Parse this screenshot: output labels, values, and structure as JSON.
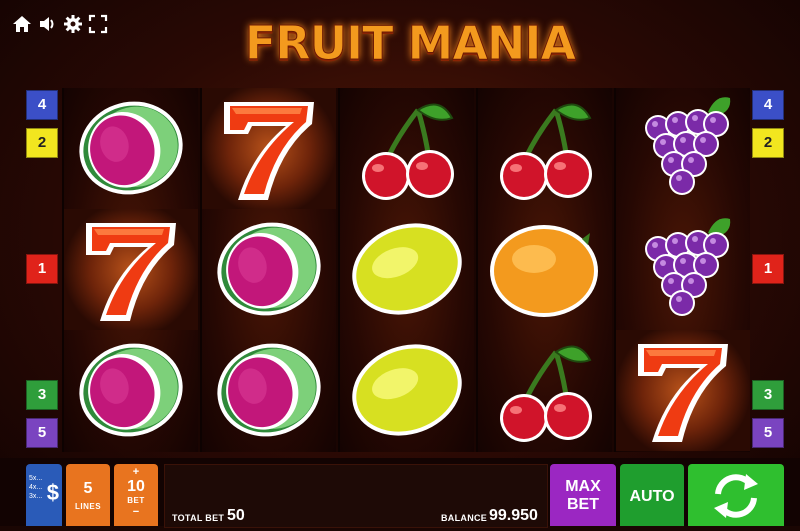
{
  "game": {
    "title": "FRUIT MANIA",
    "brand_color": "#f39a1e"
  },
  "toolbar": {
    "icons": [
      "home-icon",
      "speaker-icon",
      "gear-icon",
      "fullscreen-icon"
    ]
  },
  "reels": [
    [
      "watermelon",
      "seven",
      "watermelon"
    ],
    [
      "seven",
      "watermelon",
      "watermelon"
    ],
    [
      "cherry",
      "lemon",
      "lemon"
    ],
    [
      "cherry",
      "orange",
      "cherry"
    ],
    [
      "grapes",
      "grapes",
      "seven"
    ]
  ],
  "line_markers_left": [
    {
      "label": "4",
      "color": "#3b4fc7"
    },
    {
      "label": "2",
      "color": "#f2e61f"
    },
    {
      "label": "1",
      "color": "#e0231a"
    },
    {
      "label": "3",
      "color": "#2f9e3b"
    },
    {
      "label": "5",
      "color": "#7a44c0"
    }
  ],
  "line_markers_right": [
    {
      "label": "4",
      "color": "#3b4fc7"
    },
    {
      "label": "2",
      "color": "#f2e61f"
    },
    {
      "label": "1",
      "color": "#e0231a"
    },
    {
      "label": "3",
      "color": "#2f9e3b"
    },
    {
      "label": "5",
      "color": "#7a44c0"
    }
  ],
  "controls": {
    "paytable_icon": "dollar-icon",
    "paytable_lines": [
      "5x...",
      "4x...",
      "3x..."
    ],
    "paytable_symbol": "$",
    "lines_value": "5",
    "lines_label": "LINES",
    "bet_plus": "+",
    "bet_value": "10",
    "bet_label": "BET",
    "bet_minus": "−",
    "total_bet_label": "TOTAL BET",
    "total_bet_value": "50",
    "balance_label": "BALANCE",
    "balance_value": "99.950",
    "max_bet_line1": "MAX",
    "max_bet_line2": "BET",
    "auto_label": "AUTO",
    "spin_icon": "spin-arrows-icon"
  },
  "colors": {
    "lines_button": "#e8741f",
    "bet_button": "#e8741f",
    "max_bet_button": "#9b27c2",
    "auto_button": "#1f9e2e",
    "spin_button": "#2fbf2f",
    "paytable_button": "#2a5bb8"
  }
}
